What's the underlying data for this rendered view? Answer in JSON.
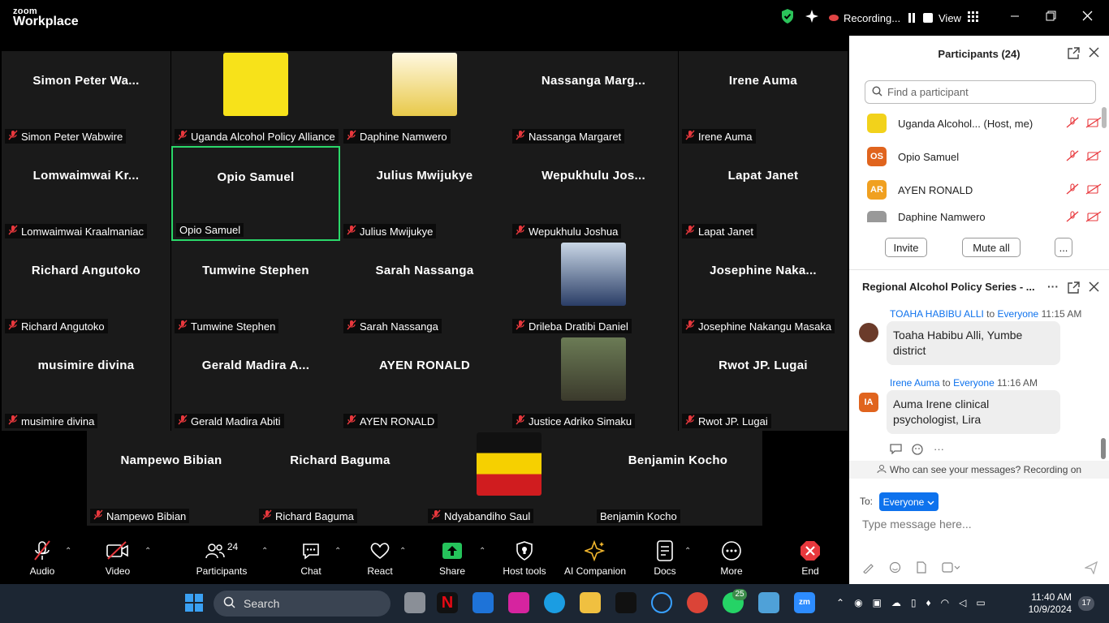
{
  "titlebar": {
    "brand_small": "zoom",
    "brand_big": "Workplace",
    "recording_label": "Recording...",
    "view_label": "View"
  },
  "tiles": [
    {
      "name": "Simon Peter Wa...",
      "label": "Simon Peter Wabwire",
      "muted": true
    },
    {
      "name": "",
      "label": "Uganda Alcohol Policy Alliance",
      "muted": true,
      "image": "uapa-logo"
    },
    {
      "name": "",
      "label": "Daphine Namwero",
      "muted": true,
      "image": "photo-woman"
    },
    {
      "name": "Nassanga Marg...",
      "label": "Nassanga Margaret",
      "muted": true
    },
    {
      "name": "Irene Auma",
      "label": "Irene Auma",
      "muted": true
    },
    {
      "name": "Lomwaimwai Kr...",
      "label": "Lomwaimwai Kraalmaniac",
      "muted": true
    },
    {
      "name": "Opio Samuel",
      "label": "Opio Samuel",
      "muted": false,
      "active": true
    },
    {
      "name": "Julius Mwijukye",
      "label": "Julius Mwijukye",
      "muted": true
    },
    {
      "name": "Wepukhulu Jos...",
      "label": "Wepukhulu Joshua",
      "muted": true
    },
    {
      "name": "Lapat Janet",
      "label": "Lapat Janet",
      "muted": true
    },
    {
      "name": "Richard Angutoko",
      "label": "Richard Angutoko",
      "muted": true
    },
    {
      "name": "Tumwine Stephen",
      "label": "Tumwine Stephen",
      "muted": true
    },
    {
      "name": "Sarah Nassanga",
      "label": "Sarah Nassanga",
      "muted": true
    },
    {
      "name": "",
      "label": "Drileba Dratibi Daniel",
      "muted": true,
      "image": "photo-man-suit"
    },
    {
      "name": "Josephine Naka...",
      "label": "Josephine Nakangu Masaka",
      "muted": true
    },
    {
      "name": "musimire divina",
      "label": "musimire divina",
      "muted": true
    },
    {
      "name": "Gerald Madira A...",
      "label": "Gerald Madira Abiti",
      "muted": true
    },
    {
      "name": "AYEN RONALD",
      "label": "AYEN RONALD",
      "muted": true
    },
    {
      "name": "",
      "label": "Justice Adriko Simaku",
      "muted": true,
      "image": "photo-outdoor"
    },
    {
      "name": "Rwot JP. Lugai",
      "label": "Rwot JP. Lugai",
      "muted": true
    },
    {
      "name": "Nampewo Bibian",
      "label": "Nampewo Bibian",
      "muted": true
    },
    {
      "name": "Richard Baguma",
      "label": "Richard Baguma",
      "muted": true
    },
    {
      "name": "",
      "label": "Ndyabandiho Saul",
      "muted": true,
      "image": "photo-flag"
    },
    {
      "name": "Benjamin Kocho",
      "label": "Benjamin Kocho",
      "muted": false
    }
  ],
  "toolbar": {
    "audio": "Audio",
    "video": "Video",
    "participants": "Participants",
    "participants_count": "24",
    "chat": "Chat",
    "react": "React",
    "share": "Share",
    "host_tools": "Host tools",
    "ai_companion": "AI Companion",
    "docs": "Docs",
    "more": "More",
    "end": "End"
  },
  "participants_panel": {
    "title": "Participants (24)",
    "search_placeholder": "Find a participant",
    "rows": [
      {
        "initials": "",
        "name": "Uganda Alcohol... (Host, me)",
        "color": "#f2d21b"
      },
      {
        "initials": "OS",
        "name": "Opio Samuel",
        "color": "#e0641e"
      },
      {
        "initials": "AR",
        "name": "AYEN RONALD",
        "color": "#f0a020"
      },
      {
        "initials": "",
        "name": "Daphine Namwero",
        "color": "#999999"
      }
    ],
    "invite": "Invite",
    "mute_all": "Mute all",
    "more": "..."
  },
  "chat_panel": {
    "title": "Regional Alcohol Policy Series - ...",
    "messages": [
      {
        "sender": "TOAHA HABIBU ALLI",
        "to": "to",
        "recipient": "Everyone",
        "time": "11:15 AM",
        "text": "Toaha Habibu Alli, Yumbe district",
        "initials": ""
      },
      {
        "sender": "Irene Auma",
        "to": "to",
        "recipient": "Everyone",
        "time": "11:16 AM",
        "text": "Auma Irene clinical psychologist, Lira",
        "initials": "IA"
      }
    ],
    "visibility_note": "Who can see your messages? Recording on",
    "to_label": "To:",
    "to_value": "Everyone",
    "input_placeholder": "Type message here..."
  },
  "taskbar": {
    "search": "Search",
    "time": "11:40 AM",
    "date": "10/9/2024",
    "whatsapp_badge": "25",
    "notif_count": "17"
  }
}
